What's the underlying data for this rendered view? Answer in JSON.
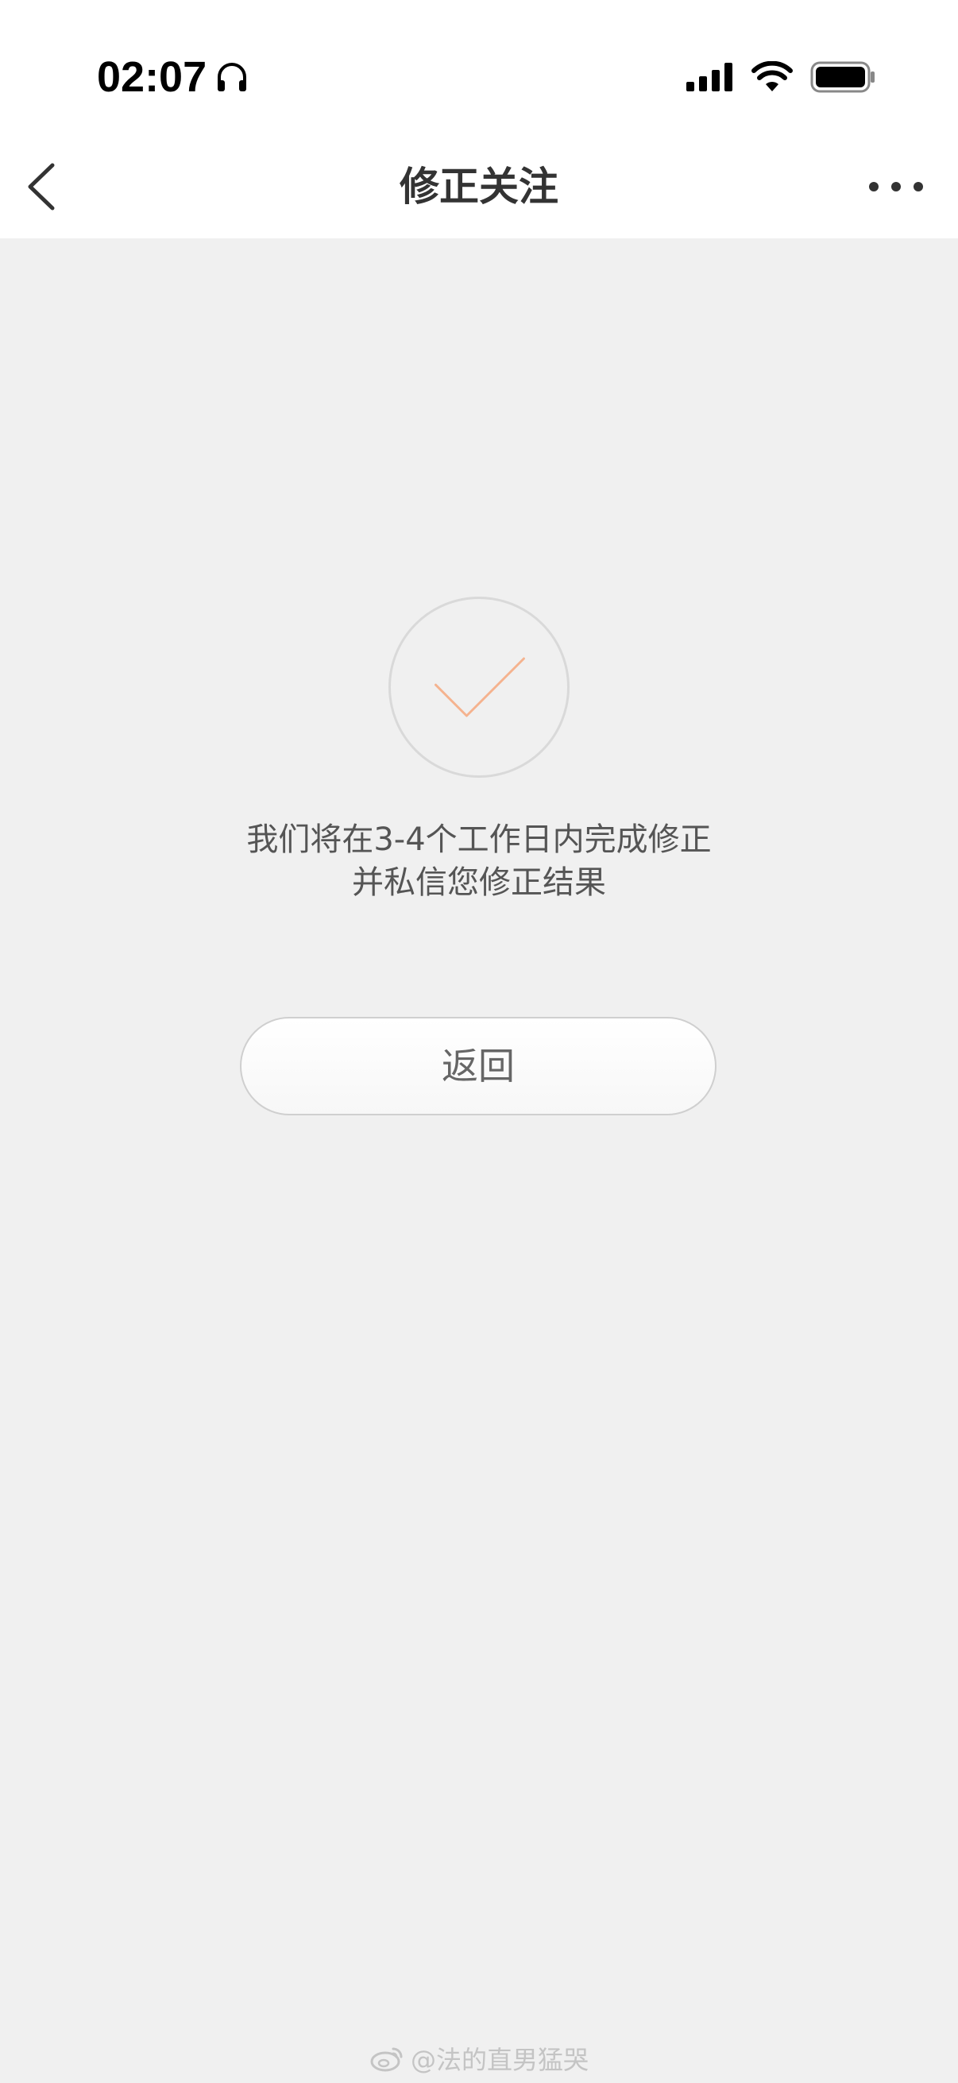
{
  "status_bar": {
    "time": "02:07",
    "icons": [
      "headphones-icon",
      "signal-icon",
      "wifi-icon",
      "battery-icon"
    ]
  },
  "nav": {
    "title": "修正关注",
    "back_icon": "chevron-left-icon",
    "more_icon": "more-dots-icon"
  },
  "result": {
    "icon": "checkmark-icon",
    "line1": "我们将在3-4个工作日内完成修正",
    "line2": "并私信您修正结果",
    "button_label": "返回"
  },
  "watermark": {
    "text": "@法的直男猛哭",
    "icon": "weibo-icon"
  },
  "colors": {
    "background": "#f0f0f0",
    "header": "#ffffff",
    "checkmark": "#f5b38f",
    "circle_border": "#d9d9d9"
  }
}
